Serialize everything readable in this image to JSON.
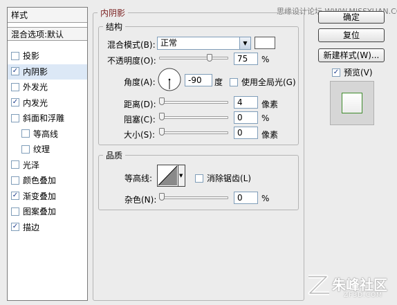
{
  "watermark_top": "思缘设计论坛  WWW.MISSYUAN.COM",
  "styles_panel": {
    "header": "样式",
    "blend_options": "混合选项:默认",
    "items": [
      {
        "label": "投影",
        "checked": false,
        "selected": false,
        "indent": false
      },
      {
        "label": "内阴影",
        "checked": true,
        "selected": true,
        "indent": false
      },
      {
        "label": "外发光",
        "checked": false,
        "selected": false,
        "indent": false
      },
      {
        "label": "内发光",
        "checked": true,
        "selected": false,
        "indent": false
      },
      {
        "label": "斜面和浮雕",
        "checked": false,
        "selected": false,
        "indent": false
      },
      {
        "label": "等高线",
        "checked": false,
        "selected": false,
        "indent": true
      },
      {
        "label": "纹理",
        "checked": false,
        "selected": false,
        "indent": true
      },
      {
        "label": "光泽",
        "checked": false,
        "selected": false,
        "indent": false
      },
      {
        "label": "颜色叠加",
        "checked": false,
        "selected": false,
        "indent": false
      },
      {
        "label": "渐变叠加",
        "checked": true,
        "selected": false,
        "indent": false
      },
      {
        "label": "图案叠加",
        "checked": false,
        "selected": false,
        "indent": false
      },
      {
        "label": "描边",
        "checked": true,
        "selected": false,
        "indent": false
      }
    ]
  },
  "inner_shadow": {
    "title": "内阴影",
    "structure": {
      "title": "结构",
      "blend_mode_label": "混合模式(B):",
      "blend_mode_value": "正常",
      "blend_color": "#ffffff",
      "opacity_label": "不透明度(O):",
      "opacity_value": "75",
      "opacity_unit": "%",
      "opacity_fraction": 0.75,
      "angle_label": "角度(A):",
      "angle_value": "-90",
      "angle_unit": "度",
      "global_light_label": "使用全局光(G)",
      "global_light_checked": false,
      "distance_label": "距离(D):",
      "distance_value": "4",
      "distance_unit": "像素",
      "choke_label": "阻塞(C):",
      "choke_value": "0",
      "choke_unit": "%",
      "size_label": "大小(S):",
      "size_value": "0",
      "size_unit": "像素"
    },
    "quality": {
      "title": "品质",
      "contour_label": "等高线:",
      "antialias_label": "消除锯齿(L)",
      "antialias_checked": false,
      "noise_label": "杂色(N):",
      "noise_value": "0",
      "noise_unit": "%"
    }
  },
  "buttons": {
    "ok": "确定",
    "reset": "复位",
    "new_style": "新建样式(W)...",
    "preview_label": "预览(V)",
    "preview_checked": true
  },
  "watermark_bottom": "朱峰社区",
  "watermark_url": "ZF3D.COM"
}
